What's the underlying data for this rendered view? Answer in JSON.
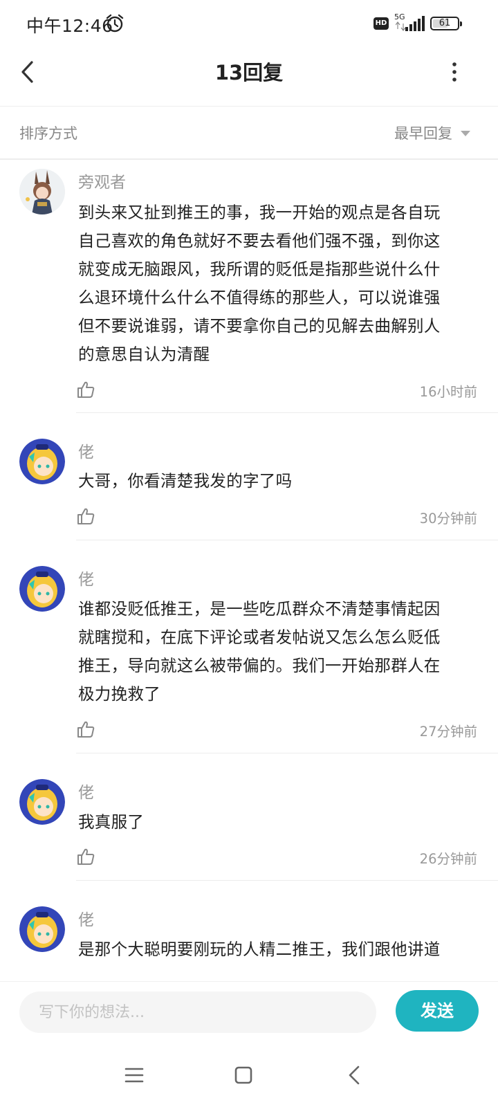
{
  "status_bar": {
    "time": "中午12:46",
    "network_badge": "HD",
    "network_type": "5G",
    "battery": "61",
    "battery_level": 0.61
  },
  "header": {
    "title": "13回复"
  },
  "sort": {
    "label": "排序方式",
    "value": "最早回复"
  },
  "comments": [
    {
      "username": "旁观者",
      "avatar": "rabbit-ear-character-avatar",
      "lines": [
        "到头来又扯到推王的事，我一开始的观点是各自玩",
        "自己喜欢的角色就好不要去看他们强不强，到你这",
        "就变成无脑跟风，我所谓的贬低是指那些说什么什",
        "么退环境什么什么不值得练的那些人，可以说谁强",
        "但不要说谁弱，请不要拿你自己的见解去曲解别人",
        "的意思自认为清醒"
      ],
      "time": "16小时前"
    },
    {
      "username": "佬",
      "avatar": "blonde-character-avatar",
      "lines": [
        "大哥，你看清楚我发的字了吗"
      ],
      "time": "30分钟前"
    },
    {
      "username": "佬",
      "avatar": "blonde-character-avatar",
      "lines": [
        "谁都没贬低推王，是一些吃瓜群众不清楚事情起因",
        "就瞎搅和，在底下评论或者发帖说又怎么怎么贬低",
        "推王，导向就这么被带偏的。我们一开始那群人在",
        "极力挽救了"
      ],
      "time": "27分钟前"
    },
    {
      "username": "佬",
      "avatar": "blonde-character-avatar",
      "lines": [
        "我真服了"
      ],
      "time": "26分钟前"
    },
    {
      "username": "佬",
      "avatar": "blonde-character-avatar",
      "lines": [
        "是那个大聪明要刚玩的人精二推王，我们跟他讲道"
      ],
      "time": ""
    }
  ],
  "composer": {
    "placeholder": "写下你的想法...",
    "send_label": "发送"
  },
  "colors": {
    "accent": "#1fb4c0",
    "secondary_text": "#999999",
    "divider": "#ececec"
  },
  "icons": {
    "back": "chevron-left-icon",
    "more": "more-vertical-icon",
    "like": "thumbs-up-icon",
    "nav": [
      "menu-icon",
      "home-square-icon",
      "back-triangle-icon"
    ]
  }
}
